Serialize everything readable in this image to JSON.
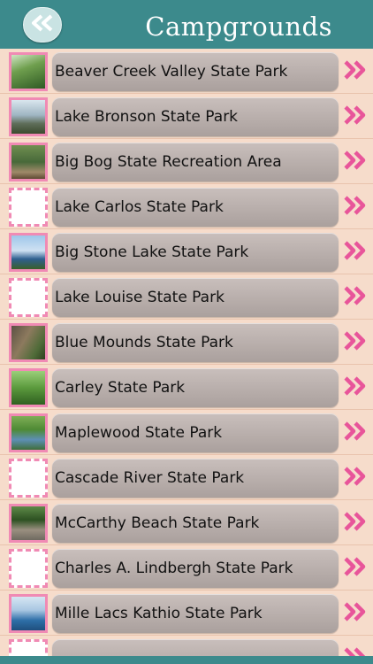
{
  "header": {
    "title": "Campgrounds"
  },
  "colors": {
    "header": "#3c8a8c",
    "background": "#f6dccb",
    "accent": "#e8559a"
  },
  "icons": {
    "back": "double-chevron-left-icon",
    "row_action": "double-chevron-right-icon"
  },
  "items": [
    {
      "label": "Beaver Creek Valley State Park",
      "thumb": "forest"
    },
    {
      "label": "Lake Bronson State Park",
      "thumb": "lake"
    },
    {
      "label": "Big Bog State Recreation Area",
      "thumb": "boardwalk"
    },
    {
      "label": "Lake Carlos State Park",
      "thumb": "blank"
    },
    {
      "label": "Big Stone Lake State Park",
      "thumb": "sky"
    },
    {
      "label": "Lake Louise State Park",
      "thumb": "blank"
    },
    {
      "label": "Blue Mounds State Park",
      "thumb": "rock"
    },
    {
      "label": "Carley State Park",
      "thumb": "green"
    },
    {
      "label": "Maplewood State Park",
      "thumb": "lake-green"
    },
    {
      "label": "Cascade River State Park",
      "thumb": "blank"
    },
    {
      "label": "McCarthy Beach State Park",
      "thumb": "steps"
    },
    {
      "label": "Charles A. Lindbergh State Park",
      "thumb": "blank"
    },
    {
      "label": "Mille Lacs Kathio State Park",
      "thumb": "water"
    },
    {
      "label": "",
      "thumb": "blank"
    }
  ]
}
